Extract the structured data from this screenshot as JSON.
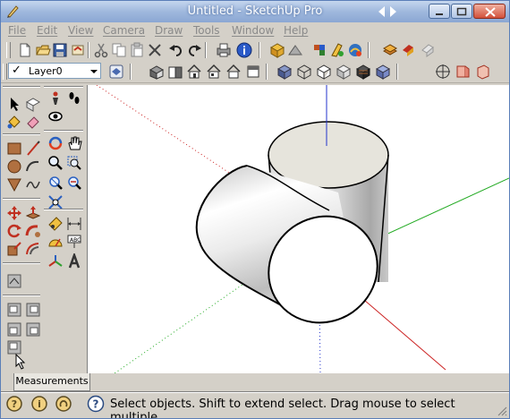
{
  "window": {
    "title": "Untitled - SketchUp Pro"
  },
  "menu": {
    "items": [
      "File",
      "Edit",
      "View",
      "Camera",
      "Draw",
      "Tools",
      "Window",
      "Help"
    ]
  },
  "layer_selector": {
    "value": "Layer0"
  },
  "measurements": {
    "label": "Measurements"
  },
  "status": {
    "text": "Select objects. Shift to extend select. Drag mouse to select multiple."
  },
  "colors": {
    "axis_red": "#cc2222",
    "axis_green": "#22aa22",
    "axis_blue": "#2233cc",
    "title_bar": "#9fb8dd",
    "chrome": "#d4d0c8"
  },
  "icons": {
    "toolbar_standard": [
      "new-icon",
      "open-icon",
      "save-icon",
      "cut-icon",
      "copy-icon",
      "paste-icon",
      "erase-icon",
      "undo-icon",
      "redo-icon",
      "print-icon",
      "model-info-icon",
      "components-icon",
      "warehouse-icon",
      "share-icon",
      "extension-icon",
      "tape-icon",
      "orbit-icon"
    ],
    "toolbar_views": [
      "iso-icon",
      "top-icon",
      "front-icon",
      "right-icon",
      "back-icon",
      "left-icon"
    ],
    "toolbar_styles": [
      "xray-icon",
      "wireframe-icon",
      "hidden-line-icon",
      "shaded-icon",
      "textured-icon",
      "monochrome-icon"
    ],
    "toolbar_sections": [
      "section-plane-icon",
      "section-display-icon",
      "section-cut-icon"
    ]
  }
}
